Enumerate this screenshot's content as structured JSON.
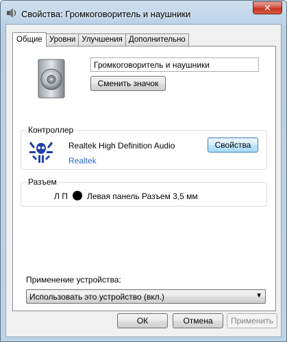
{
  "window": {
    "title": "Свойства: Громкоговоритель и наушники",
    "close_label": "✕"
  },
  "tabs": [
    {
      "label": "Общие",
      "active": true
    },
    {
      "label": "Уровни",
      "active": false
    },
    {
      "label": "Улучшения",
      "active": false
    },
    {
      "label": "Дополнительно",
      "active": false
    }
  ],
  "general": {
    "device_name": "Громкоговоритель и наушники",
    "change_icon_label": "Сменить значок",
    "controller": {
      "group_label": "Контроллер",
      "name": "Realtek High Definition Audio",
      "vendor": "Realtek",
      "properties_label": "Свойства"
    },
    "jack": {
      "group_label": "Разъем",
      "channels": "Л П",
      "description": "Левая панель Разъем 3,5 мм"
    },
    "usage": {
      "label": "Применение устройства:",
      "selected": "Использовать это устройство (вкл.)"
    }
  },
  "footer": {
    "ok_label": "ОК",
    "cancel_label": "Отмена",
    "apply_label": "Применить"
  },
  "icons": {
    "device": "speaker-icon",
    "controller": "realtek-logo-icon",
    "jack": "jack-black-icon"
  },
  "colors": {
    "accent_blue": "#3069b7",
    "realtek_blue": "#1f3fa8",
    "close_red": "#c4331f"
  }
}
